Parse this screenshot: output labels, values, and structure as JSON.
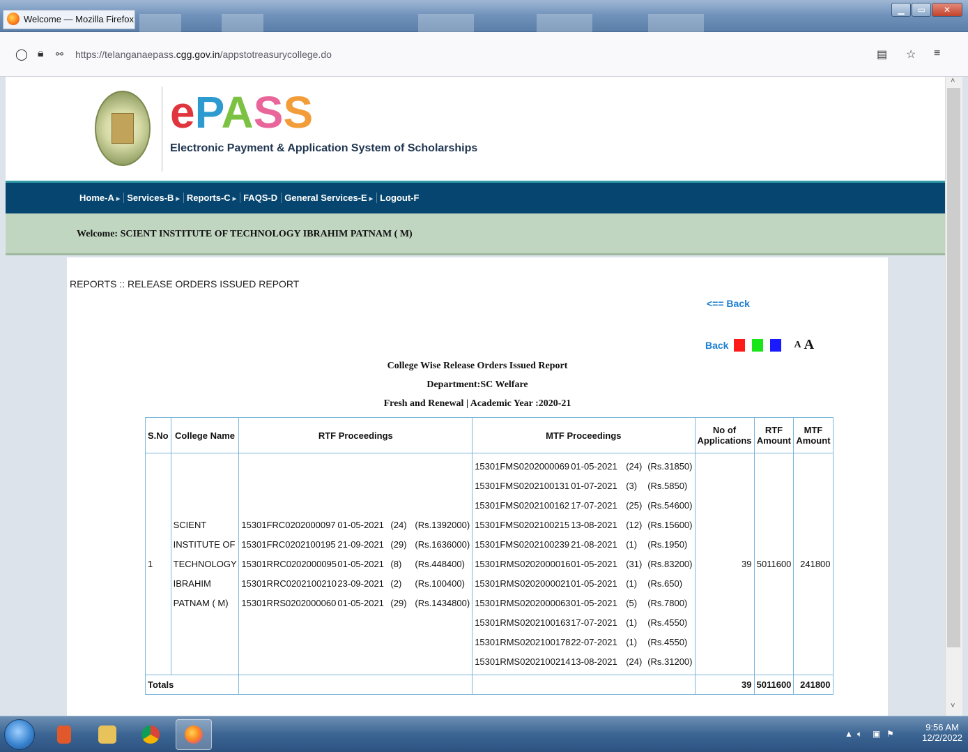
{
  "window": {
    "title": "Welcome — Mozilla Firefox",
    "url_prefix": "https://telanganaepass.",
    "url_domain": "cgg.gov.in",
    "url_path": "/appstotreasurycollege.do"
  },
  "site": {
    "logo": {
      "e": "e",
      "p": "P",
      "a": "A",
      "s1": "S",
      "s2": "S"
    },
    "tagline": "Electronic Payment & Application System of Scholarships",
    "nav": [
      "Home-A",
      "Services-B",
      "Reports-C",
      "FAQS-D",
      "General Services-E",
      "Logout-F"
    ],
    "welcome": "Welcome: SCIENT INSTITUTE OF TECHNOLOGY IBRAHIM PATNAM ( M)"
  },
  "report": {
    "page_title": "REPORTS :: RELEASE ORDERS ISSUED REPORT",
    "back_top": "<== Back",
    "back": "Back",
    "font_small": "A",
    "font_large": "A",
    "swatches": [
      "#ff1a1a",
      "#19e619",
      "#1a1aff"
    ],
    "heading1": "College Wise Release Orders Issued Report",
    "heading2": "Department:SC Welfare",
    "heading3": "Fresh and Renewal | Academic Year :2020-21",
    "columns": [
      "S.No",
      "College Name",
      "RTF Proceedings",
      "MTF Proceedings",
      "No of Applications",
      "RTF Amount",
      "MTF Amount"
    ],
    "row": {
      "sno": "1",
      "college": "SCIENT INSTITUTE OF TECHNOLOGY IBRAHIM PATNAM ( M)",
      "rtf": [
        {
          "no": "15301FRC0202000097",
          "date": "01-05-2021",
          "count": "(24)",
          "amount": "(Rs.1392000)"
        },
        {
          "no": "15301FRC0202100195",
          "date": "21-09-2021",
          "count": "(29)",
          "amount": "(Rs.1636000)"
        },
        {
          "no": "15301RRC0202000095",
          "date": "01-05-2021",
          "count": "(8)",
          "amount": "(Rs.448400)"
        },
        {
          "no": "15301RRC0202100210",
          "date": "23-09-2021",
          "count": "(2)",
          "amount": "(Rs.100400)"
        },
        {
          "no": "15301RRS0202000060",
          "date": "01-05-2021",
          "count": "(29)",
          "amount": "(Rs.1434800)"
        }
      ],
      "mtf": [
        {
          "no": "15301FMS0202000069",
          "date": "01-05-2021",
          "count": "(24)",
          "amount": "(Rs.31850)"
        },
        {
          "no": "15301FMS0202100131",
          "date": "01-07-2021",
          "count": "(3)",
          "amount": "(Rs.5850)"
        },
        {
          "no": "15301FMS0202100162",
          "date": "17-07-2021",
          "count": "(25)",
          "amount": "(Rs.54600)"
        },
        {
          "no": "15301FMS0202100215",
          "date": "13-08-2021",
          "count": "(12)",
          "amount": "(Rs.15600)"
        },
        {
          "no": "15301FMS0202100239",
          "date": "21-08-2021",
          "count": "(1)",
          "amount": "(Rs.1950)"
        },
        {
          "no": "15301RMS0202000016",
          "date": "01-05-2021",
          "count": "(31)",
          "amount": "(Rs.83200)"
        },
        {
          "no": "15301RMS0202000021",
          "date": "01-05-2021",
          "count": "(1)",
          "amount": "(Rs.650)"
        },
        {
          "no": "15301RMS0202000063",
          "date": "01-05-2021",
          "count": "(5)",
          "amount": "(Rs.7800)"
        },
        {
          "no": "15301RMS0202100163",
          "date": "17-07-2021",
          "count": "(1)",
          "amount": "(Rs.4550)"
        },
        {
          "no": "15301RMS0202100178",
          "date": "22-07-2021",
          "count": "(1)",
          "amount": "(Rs.4550)"
        },
        {
          "no": "15301RMS0202100214",
          "date": "13-08-2021",
          "count": "(24)",
          "amount": "(Rs.31200)"
        }
      ],
      "applications": "39",
      "rtf_amount": "5011600",
      "mtf_amount": "241800"
    },
    "totals": {
      "label": "Totals",
      "applications": "39",
      "rtf_amount": "5011600",
      "mtf_amount": "241800"
    }
  },
  "taskbar": {
    "time": "9:56 AM",
    "date": "12/2/2022"
  }
}
